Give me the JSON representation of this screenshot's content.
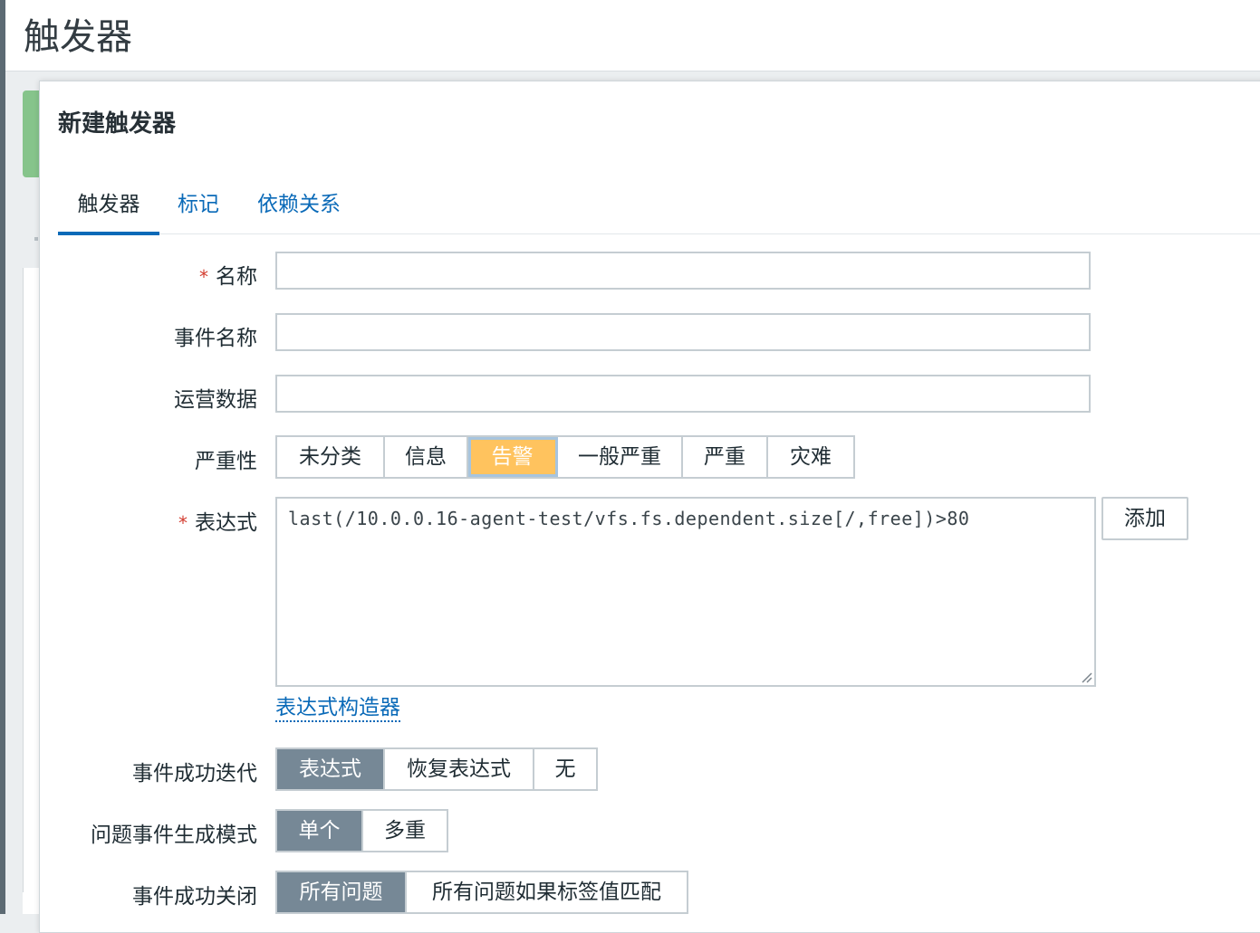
{
  "page": {
    "title": "触发器"
  },
  "dialog": {
    "title": "新建触发器",
    "tabs": [
      {
        "label": "触发器",
        "active": true
      },
      {
        "label": "标记",
        "active": false
      },
      {
        "label": "依赖关系",
        "active": false
      }
    ]
  },
  "form": {
    "name": {
      "label": "名称",
      "required": "*",
      "value": ""
    },
    "event_name": {
      "label": "事件名称",
      "value": ""
    },
    "operational_data": {
      "label": "运营数据",
      "value": ""
    },
    "severity": {
      "label": "严重性",
      "options": [
        "未分类",
        "信息",
        "告警",
        "一般严重",
        "严重",
        "灾难"
      ],
      "selected": "告警"
    },
    "expression": {
      "label": "表达式",
      "required": "*",
      "value": "last(/10.0.0.16-agent-test/vfs.fs.dependent.size[/,free])>80",
      "add_button": "添加",
      "builder_link": "表达式构造器"
    },
    "ok_event_generation": {
      "label": "事件成功迭代",
      "options": [
        "表达式",
        "恢复表达式",
        "无"
      ],
      "selected": "表达式"
    },
    "problem_event_mode": {
      "label": "问题事件生成模式",
      "options": [
        "单个",
        "多重"
      ],
      "selected": "单个"
    },
    "ok_event_closes": {
      "label": "事件成功关闭",
      "options": [
        "所有问题",
        "所有问题如果标签值匹配"
      ],
      "selected": "所有问题"
    }
  },
  "colors": {
    "link": "#0a6ab8",
    "severity_warning": "#ffc35e",
    "segment_selected": "#768896",
    "required": "#d33c2f"
  }
}
